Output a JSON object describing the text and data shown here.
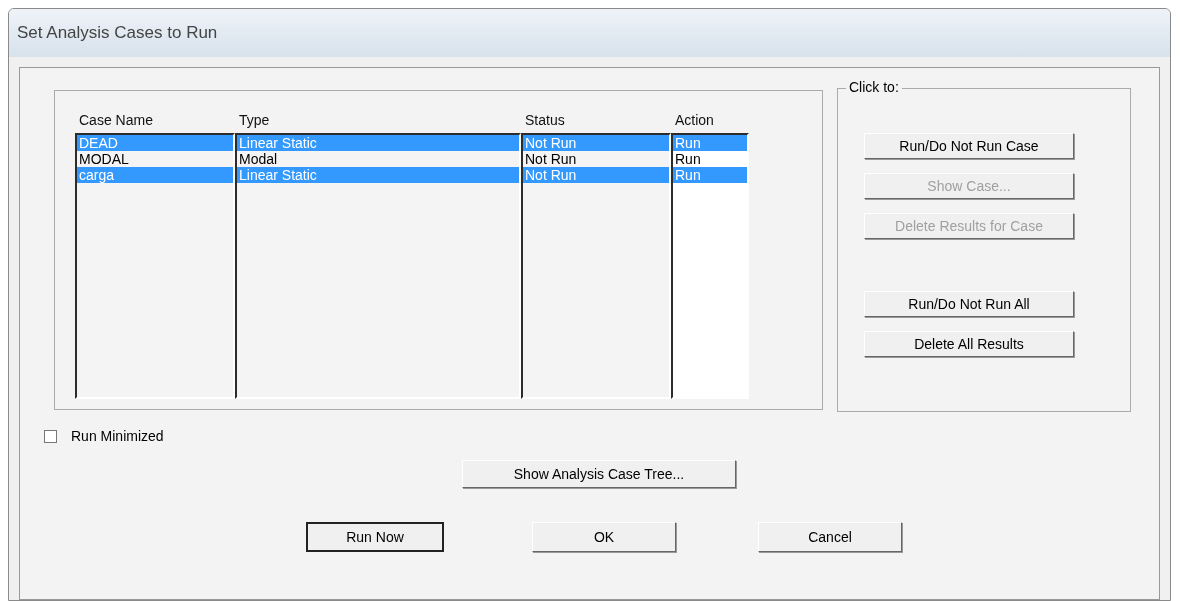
{
  "window": {
    "title": "Set Analysis Cases to Run"
  },
  "cases": {
    "columns": [
      "Case Name",
      "Type",
      "Status",
      "Action"
    ],
    "rows": [
      {
        "cells": [
          "DEAD",
          "Linear Static",
          "Not Run",
          "Run"
        ],
        "selected": true
      },
      {
        "cells": [
          "MODAL",
          "Modal",
          "Not Run",
          "Run"
        ],
        "selected": false
      },
      {
        "cells": [
          "carga",
          "Linear Static",
          "Not Run",
          "Run"
        ],
        "selected": true
      }
    ]
  },
  "click_to": {
    "label": "Click to:",
    "buttons": [
      {
        "label": "Run/Do Not Run Case",
        "disabled": false
      },
      {
        "label": "Show Case...",
        "disabled": true
      },
      {
        "label": "Delete Results for Case",
        "disabled": true
      },
      {
        "label": "Run/Do Not Run All",
        "disabled": false
      },
      {
        "label": "Delete All Results",
        "disabled": false
      }
    ]
  },
  "run_minimized": {
    "label": "Run Minimized",
    "checked": false
  },
  "tree_button": "Show Analysis Case Tree...",
  "buttons": [
    {
      "label": "Run Now",
      "default": true
    },
    {
      "label": "OK",
      "default": false
    },
    {
      "label": "Cancel",
      "default": false
    }
  ]
}
